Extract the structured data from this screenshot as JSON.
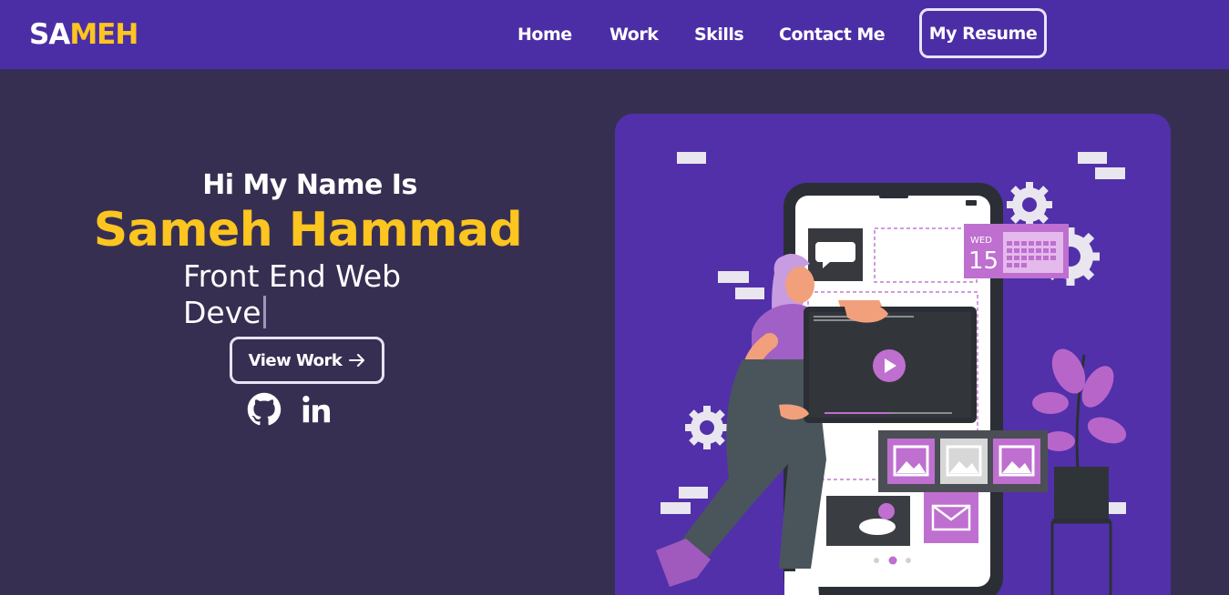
{
  "navbar": {
    "logo": {
      "part1": "SA",
      "part2": "MEH"
    },
    "links": [
      {
        "label": "Home"
      },
      {
        "label": "Work"
      },
      {
        "label": "Skills"
      },
      {
        "label": "Contact Me"
      }
    ],
    "resume_button": "My Resume"
  },
  "hero": {
    "greeting": "Hi My Name Is",
    "name": "Sameh Hammad",
    "typed_line1": "Front End Web",
    "typed_line2": "Deve",
    "view_work_button": "View Work",
    "view_work_icon": "arrow-right-icon",
    "social": [
      {
        "icon": "github-icon"
      },
      {
        "icon": "linkedin-icon"
      }
    ]
  },
  "illustration": {
    "calendar_day": "WED",
    "calendar_date": "15"
  },
  "colors": {
    "navbar_bg": "#4b2ea6",
    "page_bg": "#372f52",
    "accent_yellow": "#fcc51f",
    "illustration_bg": "#5130aa"
  }
}
